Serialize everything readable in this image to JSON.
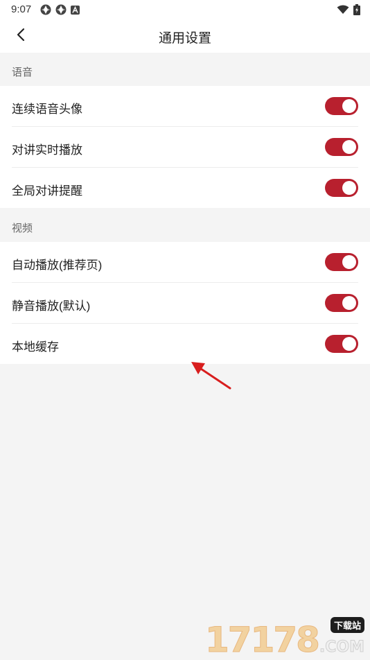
{
  "status_bar": {
    "time": "9:07",
    "left_icons": [
      "sync-app-icon",
      "sync-app-icon",
      "a-app-icon"
    ],
    "right_icons": [
      "wifi-icon",
      "battery-charging-icon"
    ]
  },
  "header": {
    "title": "通用设置",
    "back_icon": "chevron-left-icon"
  },
  "sections": [
    {
      "title": "语音",
      "items": [
        {
          "label": "连续语音头像",
          "enabled": true
        },
        {
          "label": "对讲实时播放",
          "enabled": true
        },
        {
          "label": "全局对讲提醒",
          "enabled": true
        }
      ]
    },
    {
      "title": "视频",
      "items": [
        {
          "label": "自动播放(推荐页)",
          "enabled": true
        },
        {
          "label": "静音播放(默认)",
          "enabled": true
        },
        {
          "label": "本地缓存",
          "enabled": true
        }
      ]
    }
  ],
  "watermark": {
    "digits": "17178",
    "badge": "下载站",
    "suffix": ".COM"
  },
  "colors": {
    "accent": "#b8202e",
    "background": "#f4f4f4",
    "surface": "#ffffff",
    "annotation_arrow": "#d81e1e"
  }
}
